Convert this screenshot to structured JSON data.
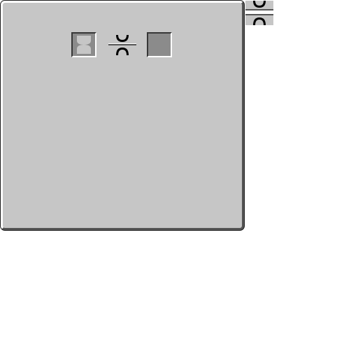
{
  "gui": {
    "panel_color": "#c6c6c6",
    "slot_color": "#8b8b8b",
    "icon_dark": "#000000",
    "icon_light": "#c6c6c6"
  },
  "slots": [
    {
      "role": "input",
      "icon": "hourglass-icon"
    },
    {
      "role": "output",
      "icon": ""
    }
  ],
  "progress": {
    "icon": "compress-arrow-icon",
    "value": 0
  },
  "sprites": [
    {
      "icon": "compress-top-sprite"
    },
    {
      "icon": "compress-bottom-sprite"
    }
  ]
}
